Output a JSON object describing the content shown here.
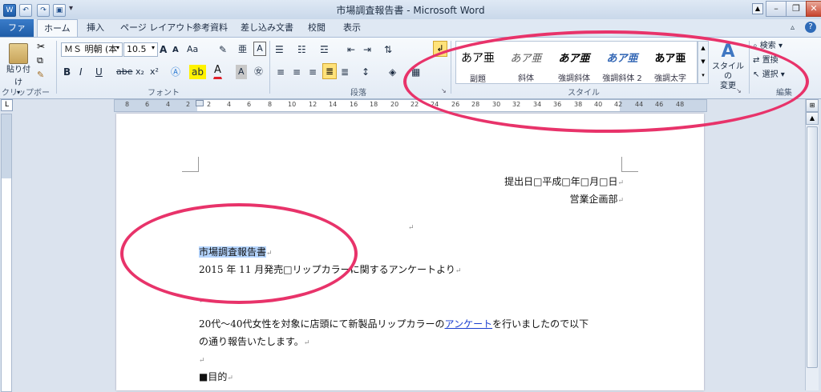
{
  "window": {
    "title": "市場調査報告書 - Microsoft Word"
  },
  "tabs": [
    "ファイル",
    "ホーム",
    "挿入",
    "ページ レイアウト",
    "参考資料",
    "差し込み文書",
    "校閲",
    "表示"
  ],
  "clipboard": {
    "paste_label": "貼り付け",
    "group_label": "クリップボード"
  },
  "font": {
    "family_value": "ＭＳ 明朝 (本",
    "size_value": "10.5",
    "group_label": "フォント",
    "bold": "B",
    "italic": "I",
    "underline": "U",
    "strike": "abe",
    "subscript": "x₂",
    "superscript": "x²",
    "grow": "A",
    "shrink": "A",
    "case": "Aa",
    "font_color": "A"
  },
  "paragraph": {
    "group_label": "段落"
  },
  "styles": {
    "group_label": "スタイル",
    "items": [
      {
        "sample": "あア亜",
        "name": "副題"
      },
      {
        "sample": "あア亜",
        "name": "斜体"
      },
      {
        "sample": "あア亜",
        "name": "強調斜体"
      },
      {
        "sample": "あア亜",
        "name": "強調斜体 2"
      },
      {
        "sample": "あア亜",
        "name": "強調太字"
      }
    ],
    "change_label_1": "スタイルの",
    "change_label_2": "変更"
  },
  "editing": {
    "find": "検索",
    "replace": "置換",
    "select": "選択",
    "group_label": "編集"
  },
  "ruler": {
    "ticks": [
      "8",
      "6",
      "4",
      "2",
      "2",
      "4",
      "6",
      "8",
      "10",
      "12",
      "14",
      "16",
      "18",
      "20",
      "22",
      "24",
      "26",
      "28",
      "30",
      "32",
      "34",
      "36",
      "38",
      "40",
      "42",
      "44",
      "46",
      "48"
    ]
  },
  "document": {
    "date_line": "提出日□平成□年□月□日",
    "dept_line": "営業企画部",
    "title": "市場調査報告書",
    "subtitle": "2015 年 11 月発売□リップカラーに関するアンケートより",
    "body_line1_prefix": "20代～40代女性を対象に店頭にて新製品リップカラーの",
    "body_link": "アンケート",
    "body_line1_suffix": "を行いましたので以下",
    "body_line2": "の通り報告いたします。",
    "section_heading": "■目的",
    "para_mark": "↵"
  },
  "colors": {
    "annotation": "#e8336a",
    "selection": "#b5d5ff",
    "file_tab": "#1f5da8",
    "link": "#1a3ecf"
  }
}
